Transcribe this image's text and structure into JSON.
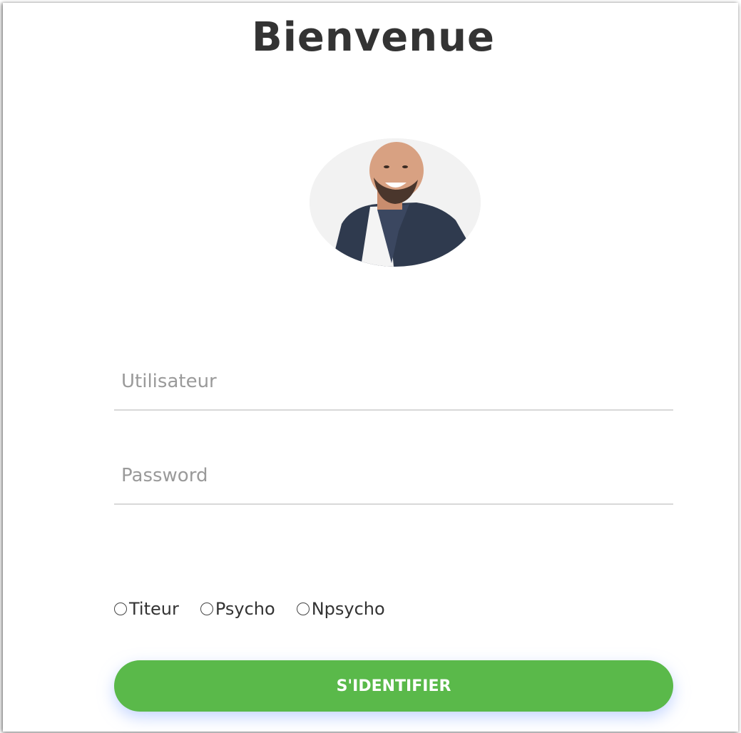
{
  "header": {
    "title": "Bienvenue"
  },
  "avatar": {
    "icon": "user-avatar-photo"
  },
  "form": {
    "username_placeholder": "Utilisateur",
    "username_value": "",
    "password_placeholder": "Password",
    "password_value": "",
    "roles": [
      {
        "label": "Titeur",
        "checked": false
      },
      {
        "label": "Psycho",
        "checked": false
      },
      {
        "label": "Npsycho",
        "checked": false
      }
    ],
    "submit_label": "S'IDENTIFIER"
  },
  "colors": {
    "accent": "#5ab94a",
    "title": "#333333"
  }
}
